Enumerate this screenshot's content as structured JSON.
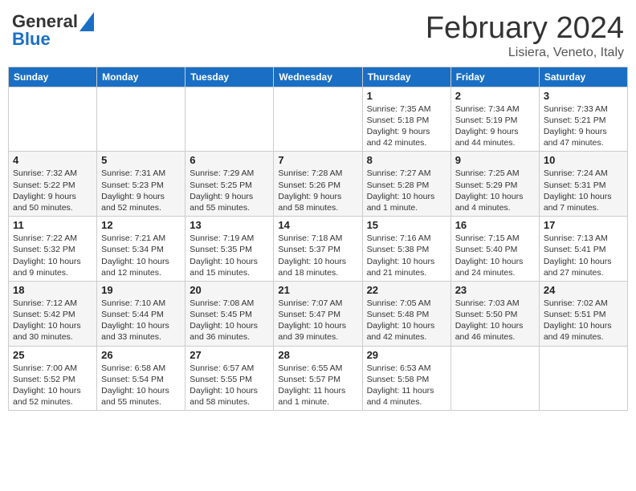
{
  "header": {
    "logo_line1": "General",
    "logo_line2": "Blue",
    "month": "February 2024",
    "location": "Lisiera, Veneto, Italy"
  },
  "columns": [
    "Sunday",
    "Monday",
    "Tuesday",
    "Wednesday",
    "Thursday",
    "Friday",
    "Saturday"
  ],
  "weeks": [
    [
      {
        "day": "",
        "info": ""
      },
      {
        "day": "",
        "info": ""
      },
      {
        "day": "",
        "info": ""
      },
      {
        "day": "",
        "info": ""
      },
      {
        "day": "1",
        "info": "Sunrise: 7:35 AM\nSunset: 5:18 PM\nDaylight: 9 hours and 42 minutes."
      },
      {
        "day": "2",
        "info": "Sunrise: 7:34 AM\nSunset: 5:19 PM\nDaylight: 9 hours and 44 minutes."
      },
      {
        "day": "3",
        "info": "Sunrise: 7:33 AM\nSunset: 5:21 PM\nDaylight: 9 hours and 47 minutes."
      }
    ],
    [
      {
        "day": "4",
        "info": "Sunrise: 7:32 AM\nSunset: 5:22 PM\nDaylight: 9 hours and 50 minutes."
      },
      {
        "day": "5",
        "info": "Sunrise: 7:31 AM\nSunset: 5:23 PM\nDaylight: 9 hours and 52 minutes."
      },
      {
        "day": "6",
        "info": "Sunrise: 7:29 AM\nSunset: 5:25 PM\nDaylight: 9 hours and 55 minutes."
      },
      {
        "day": "7",
        "info": "Sunrise: 7:28 AM\nSunset: 5:26 PM\nDaylight: 9 hours and 58 minutes."
      },
      {
        "day": "8",
        "info": "Sunrise: 7:27 AM\nSunset: 5:28 PM\nDaylight: 10 hours and 1 minute."
      },
      {
        "day": "9",
        "info": "Sunrise: 7:25 AM\nSunset: 5:29 PM\nDaylight: 10 hours and 4 minutes."
      },
      {
        "day": "10",
        "info": "Sunrise: 7:24 AM\nSunset: 5:31 PM\nDaylight: 10 hours and 7 minutes."
      }
    ],
    [
      {
        "day": "11",
        "info": "Sunrise: 7:22 AM\nSunset: 5:32 PM\nDaylight: 10 hours and 9 minutes."
      },
      {
        "day": "12",
        "info": "Sunrise: 7:21 AM\nSunset: 5:34 PM\nDaylight: 10 hours and 12 minutes."
      },
      {
        "day": "13",
        "info": "Sunrise: 7:19 AM\nSunset: 5:35 PM\nDaylight: 10 hours and 15 minutes."
      },
      {
        "day": "14",
        "info": "Sunrise: 7:18 AM\nSunset: 5:37 PM\nDaylight: 10 hours and 18 minutes."
      },
      {
        "day": "15",
        "info": "Sunrise: 7:16 AM\nSunset: 5:38 PM\nDaylight: 10 hours and 21 minutes."
      },
      {
        "day": "16",
        "info": "Sunrise: 7:15 AM\nSunset: 5:40 PM\nDaylight: 10 hours and 24 minutes."
      },
      {
        "day": "17",
        "info": "Sunrise: 7:13 AM\nSunset: 5:41 PM\nDaylight: 10 hours and 27 minutes."
      }
    ],
    [
      {
        "day": "18",
        "info": "Sunrise: 7:12 AM\nSunset: 5:42 PM\nDaylight: 10 hours and 30 minutes."
      },
      {
        "day": "19",
        "info": "Sunrise: 7:10 AM\nSunset: 5:44 PM\nDaylight: 10 hours and 33 minutes."
      },
      {
        "day": "20",
        "info": "Sunrise: 7:08 AM\nSunset: 5:45 PM\nDaylight: 10 hours and 36 minutes."
      },
      {
        "day": "21",
        "info": "Sunrise: 7:07 AM\nSunset: 5:47 PM\nDaylight: 10 hours and 39 minutes."
      },
      {
        "day": "22",
        "info": "Sunrise: 7:05 AM\nSunset: 5:48 PM\nDaylight: 10 hours and 42 minutes."
      },
      {
        "day": "23",
        "info": "Sunrise: 7:03 AM\nSunset: 5:50 PM\nDaylight: 10 hours and 46 minutes."
      },
      {
        "day": "24",
        "info": "Sunrise: 7:02 AM\nSunset: 5:51 PM\nDaylight: 10 hours and 49 minutes."
      }
    ],
    [
      {
        "day": "25",
        "info": "Sunrise: 7:00 AM\nSunset: 5:52 PM\nDaylight: 10 hours and 52 minutes."
      },
      {
        "day": "26",
        "info": "Sunrise: 6:58 AM\nSunset: 5:54 PM\nDaylight: 10 hours and 55 minutes."
      },
      {
        "day": "27",
        "info": "Sunrise: 6:57 AM\nSunset: 5:55 PM\nDaylight: 10 hours and 58 minutes."
      },
      {
        "day": "28",
        "info": "Sunrise: 6:55 AM\nSunset: 5:57 PM\nDaylight: 11 hours and 1 minute."
      },
      {
        "day": "29",
        "info": "Sunrise: 6:53 AM\nSunset: 5:58 PM\nDaylight: 11 hours and 4 minutes."
      },
      {
        "day": "",
        "info": ""
      },
      {
        "day": "",
        "info": ""
      }
    ]
  ]
}
